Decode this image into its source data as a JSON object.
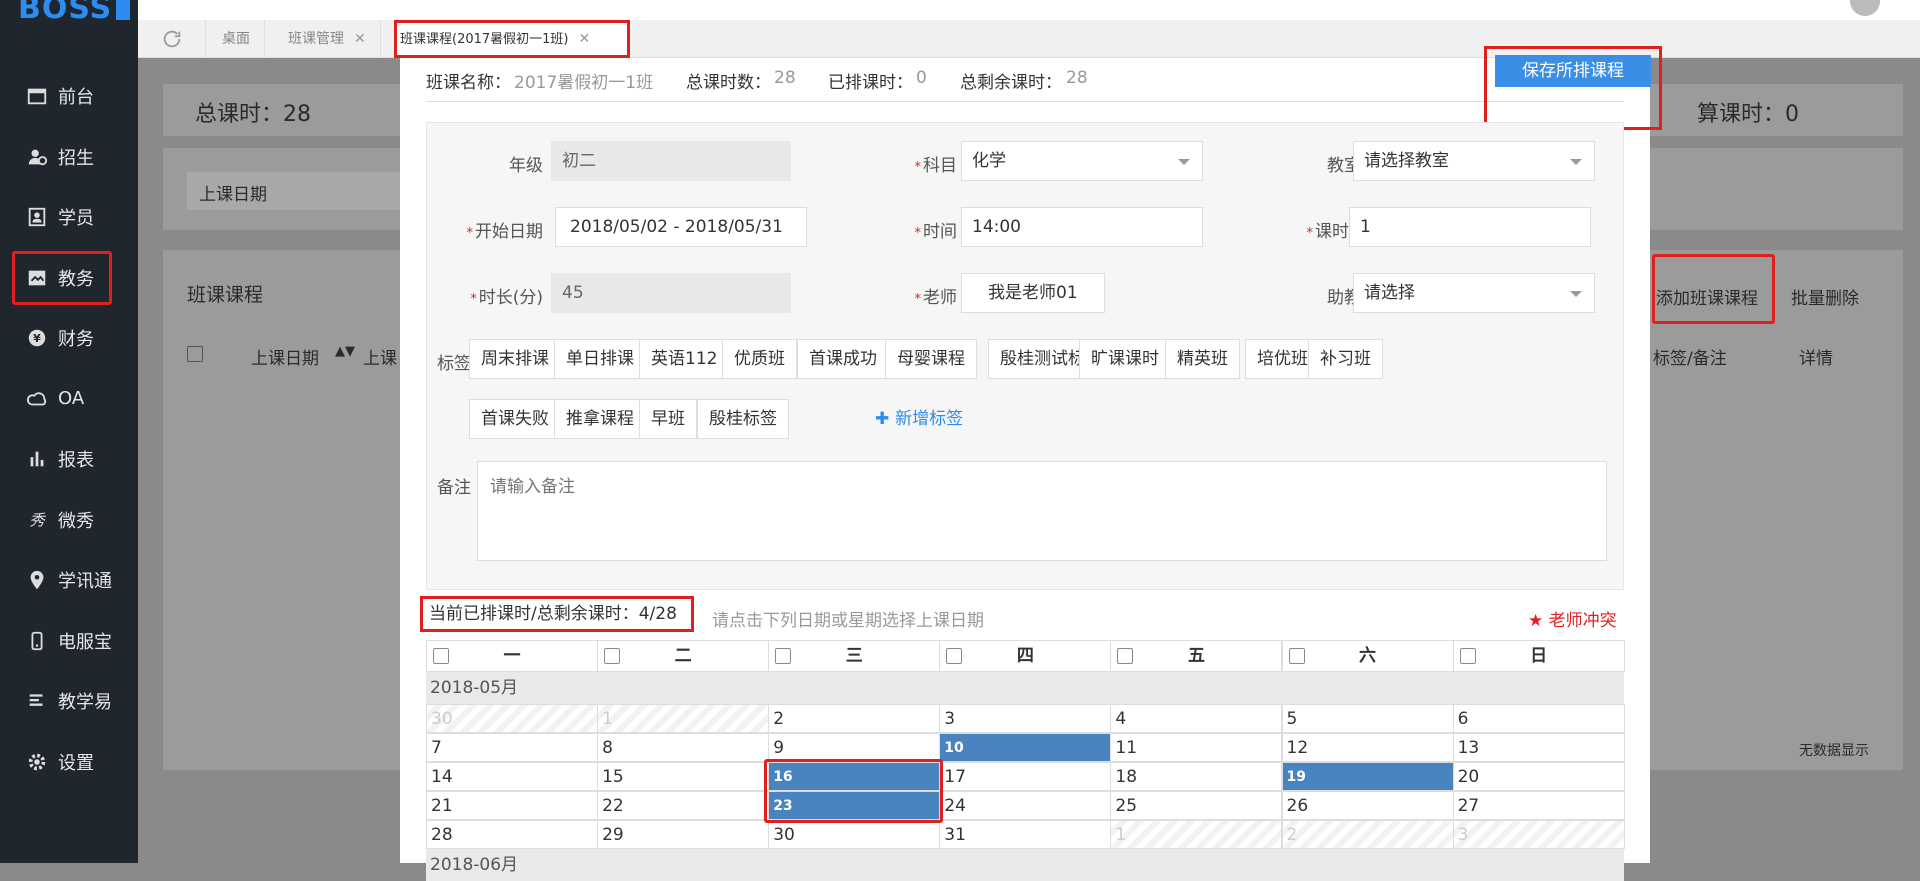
{
  "app": {
    "logo": "BOSS"
  },
  "sidebar": {
    "items": [
      {
        "label": "前台",
        "icon": "calendar-icon"
      },
      {
        "label": "招生",
        "icon": "add-user-icon"
      },
      {
        "label": "学员",
        "icon": "id-card-icon"
      },
      {
        "label": "教务",
        "icon": "book-icon"
      },
      {
        "label": "财务",
        "icon": "yen-icon"
      },
      {
        "label": "OA",
        "icon": "cloud-icon"
      },
      {
        "label": "报表",
        "icon": "bar-chart-icon"
      },
      {
        "label": "微秀",
        "icon": "show-icon"
      },
      {
        "label": "学讯通",
        "icon": "location-icon"
      },
      {
        "label": "电服宝",
        "icon": "phone-icon"
      },
      {
        "label": "教学易",
        "icon": "teach-icon"
      },
      {
        "label": "设置",
        "icon": "gear-icon"
      }
    ]
  },
  "tabs": [
    {
      "label": "桌面"
    },
    {
      "label": "班课管理"
    },
    {
      "label": "班课课程(2017暑假初一1班)"
    }
  ],
  "background": {
    "total_hours": "总课时：28",
    "sched_hours": "算课时：0",
    "date_filter": "上课日期",
    "section_title": "班课课程",
    "add_button": "添加班课课程",
    "batch_delete": "批量删除",
    "col_date": "上课日期",
    "col_date2": "上课",
    "col_tag": "标签/备注",
    "col_detail": "详情",
    "no_data": "无数据显示"
  },
  "modal": {
    "class_name_label": "班课名称：",
    "class_name_value": "2017暑假初一1班",
    "total_label": "总课时数：",
    "total_value": "28",
    "scheduled_label": "已排课时：",
    "scheduled_value": "0",
    "remaining_label": "总剩余课时：",
    "remaining_value": "28",
    "save_button": "保存所排课程"
  },
  "form": {
    "grade_label": "年级",
    "grade_value": "初二",
    "subject_label": "科目",
    "subject_value": "化学",
    "room_label": "教室",
    "room_value": "请选择教室",
    "start_label": "开始日期",
    "start_value": "2018/05/02 - 2018/05/31",
    "time_label": "时间",
    "time_value": "14:00",
    "hours_label": "课时",
    "hours_value": "1",
    "duration_label": "时长(分)",
    "duration_value": "45",
    "teacher_label": "老师",
    "teacher_value": "我是老师01",
    "assistant_label": "助教",
    "assistant_value": "请选择",
    "tags_label": "标签",
    "tags": [
      "周末排课",
      "单日排课",
      "英语112",
      "优质班",
      "首课成功",
      "母婴课程",
      "殷桂测试标签",
      "旷课课时",
      "精英班",
      "培优班",
      "补习班",
      "首课失败",
      "推拿课程",
      "早班",
      "殷桂标签"
    ],
    "add_tag": "新增标签",
    "note_label": "备注",
    "note_placeholder": "请输入备注"
  },
  "schedule": {
    "status": "当前已排课时/总剩余课时：4/28",
    "hint": "请点击下列日期或星期选择上课日期",
    "conflict": "老师冲突"
  },
  "calendar": {
    "weekdays": [
      "一",
      "二",
      "三",
      "四",
      "五",
      "六",
      "日"
    ],
    "month_label": "2018-05月",
    "weeks": [
      [
        "30",
        "1",
        "2",
        "3",
        "4",
        "5",
        "6"
      ],
      [
        "7",
        "8",
        "9",
        "10",
        "11",
        "12",
        "13"
      ],
      [
        "14",
        "15",
        "16",
        "17",
        "18",
        "19",
        "20"
      ],
      [
        "21",
        "22",
        "23",
        "24",
        "25",
        "26",
        "27"
      ],
      [
        "28",
        "29",
        "30",
        "31",
        "1",
        "2",
        "3"
      ]
    ],
    "next_month_partial": "2018-06月",
    "selected": [
      "10",
      "16",
      "19",
      "23"
    ]
  }
}
